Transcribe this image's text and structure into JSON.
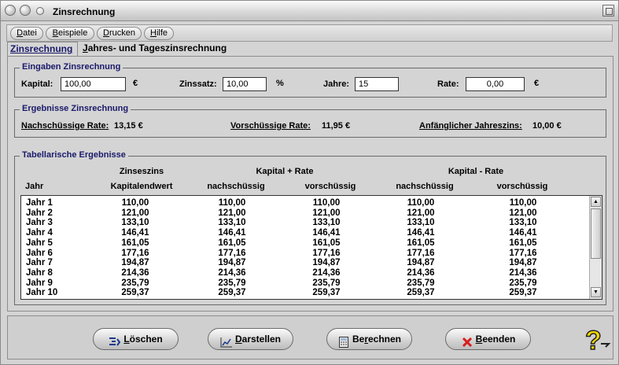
{
  "window": {
    "title": "Zinsrechnung"
  },
  "menu": [
    {
      "label_u": "D",
      "label_rest": "atei"
    },
    {
      "label_u": "B",
      "label_rest": "eispiele"
    },
    {
      "label_u": "D",
      "label_rest": "rucken"
    },
    {
      "label_u": "H",
      "label_rest": "ilfe"
    }
  ],
  "tabs": {
    "active": "Zinsrechnung",
    "inactive_u": "J",
    "inactive_rest": "ahres- und Tageszinsrechnung"
  },
  "inputs": {
    "group_title": "Eingaben Zinsrechnung",
    "kapital_label": "Kapital:",
    "kapital_value": "100,00",
    "kapital_unit": "€",
    "zinssatz_label": "Zinssatz:",
    "zinssatz_value": "10,00",
    "zinssatz_unit": "%",
    "jahre_label": "Jahre:",
    "jahre_value": "15",
    "rate_label": "Rate:",
    "rate_value": "0,00",
    "rate_unit": "€"
  },
  "results": {
    "group_title": "Ergebnisse Zinsrechnung",
    "nach_label": "Nachschüssige Rate:",
    "nach_value": "13,15 €",
    "vor_label": "Vorschüssige Rate:",
    "vor_value": "11,95 €",
    "jz_label": "Anfänglicher Jahreszins:",
    "jz_value": "10,00 €"
  },
  "table": {
    "group_title": "Tabellarische Ergebnisse",
    "header_top": {
      "zinseszins": "Zinseszins",
      "kapital_plus": "Kapital + Rate",
      "kapital_minus": "Kapital - Rate"
    },
    "header_bottom": {
      "jahr": "Jahr",
      "kapitalendwert": "Kapitalendwert",
      "plus_nach": "nachschüssig",
      "plus_vor": "vorschüssig",
      "minus_nach": "nachschüssig",
      "minus_vor": "vorschüssig"
    },
    "rows": [
      [
        "Jahr 1",
        "110,00",
        "110,00",
        "110,00",
        "110,00",
        "110,00"
      ],
      [
        "Jahr 2",
        "121,00",
        "121,00",
        "121,00",
        "121,00",
        "121,00"
      ],
      [
        "Jahr 3",
        "133,10",
        "133,10",
        "133,10",
        "133,10",
        "133,10"
      ],
      [
        "Jahr 4",
        "146,41",
        "146,41",
        "146,41",
        "146,41",
        "146,41"
      ],
      [
        "Jahr 5",
        "161,05",
        "161,05",
        "161,05",
        "161,05",
        "161,05"
      ],
      [
        "Jahr 6",
        "177,16",
        "177,16",
        "177,16",
        "177,16",
        "177,16"
      ],
      [
        "Jahr 7",
        "194,87",
        "194,87",
        "194,87",
        "194,87",
        "194,87"
      ],
      [
        "Jahr 8",
        "214,36",
        "214,36",
        "214,36",
        "214,36",
        "214,36"
      ],
      [
        "Jahr 9",
        "235,79",
        "235,79",
        "235,79",
        "235,79",
        "235,79"
      ],
      [
        "Jahr 10",
        "259,37",
        "259,37",
        "259,37",
        "259,37",
        "259,37"
      ]
    ]
  },
  "buttons": {
    "loeschen_u": "L",
    "loeschen_rest": "öschen",
    "darstellen_u": "D",
    "darstellen_rest": "arstellen",
    "berechnen_pre": "Be",
    "berechnen_u": "r",
    "berechnen_rest": "echnen",
    "beenden_u": "B",
    "beenden_rest": "eenden"
  },
  "colors": {
    "group_title": "#1a1a6b",
    "help_icon": "#f5d800",
    "exit_x": "#d81c1c"
  }
}
